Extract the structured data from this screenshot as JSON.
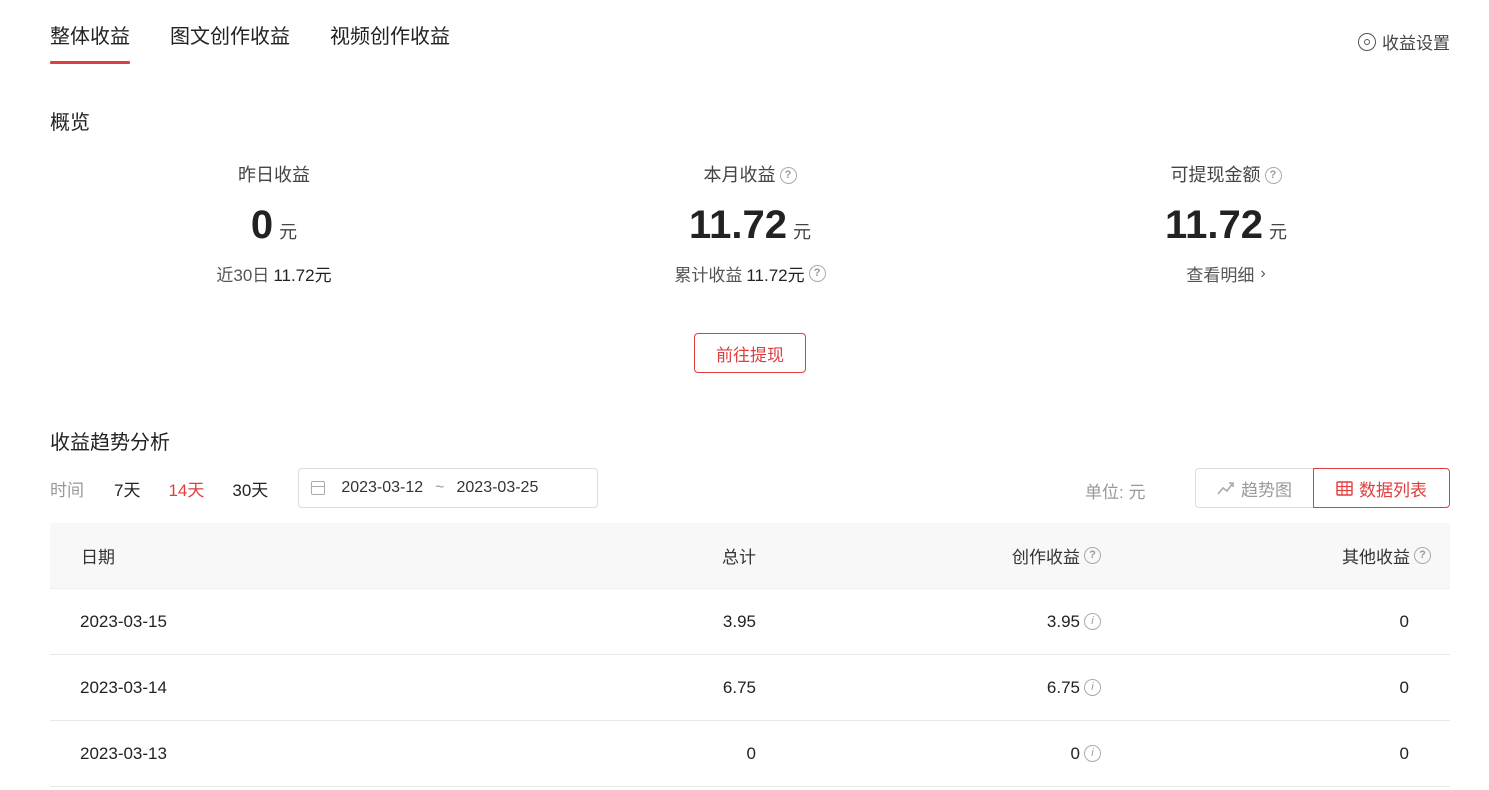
{
  "tabs": [
    {
      "label": "整体收益",
      "active": true
    },
    {
      "label": "图文创作收益",
      "active": false
    },
    {
      "label": "视频创作收益",
      "active": false
    }
  ],
  "settings_label": "收益设置",
  "overview": {
    "title": "概览",
    "stats": [
      {
        "label": "昨日收益",
        "value": "0",
        "unit": "元",
        "sub_label": "近30日",
        "sub_value": "11.72元"
      },
      {
        "label": "本月收益",
        "value": "11.72",
        "unit": "元",
        "sub_label": "累计收益",
        "sub_value": "11.72元"
      },
      {
        "label": "可提现金额",
        "value": "11.72",
        "unit": "元",
        "link_label": "查看明细"
      }
    ],
    "withdraw_button": "前往提现"
  },
  "trend": {
    "title": "收益趋势分析",
    "time_label": "时间",
    "ranges": [
      "7天",
      "14天",
      "30天"
    ],
    "active_range": "14天",
    "date_start": "2023-03-12",
    "date_separator": "~",
    "date_end": "2023-03-25",
    "unit_label": "单位: 元",
    "view_trend": "趋势图",
    "view_list": "数据列表"
  },
  "table": {
    "headers": {
      "date": "日期",
      "total": "总计",
      "create": "创作收益",
      "other": "其他收益"
    },
    "rows": [
      {
        "date": "2023-03-15",
        "total": "3.95",
        "create": "3.95",
        "other": "0"
      },
      {
        "date": "2023-03-14",
        "total": "6.75",
        "create": "6.75",
        "other": "0"
      },
      {
        "date": "2023-03-13",
        "total": "0",
        "create": "0",
        "other": "0"
      }
    ]
  },
  "colors": {
    "accent": "#e03e3e",
    "muted": "#999999",
    "text": "#222222"
  }
}
